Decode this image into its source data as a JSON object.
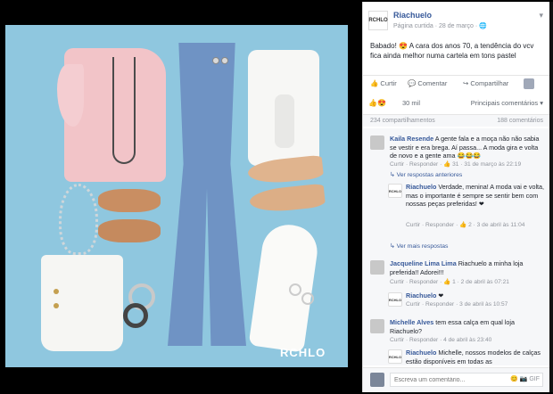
{
  "page": {
    "name": "Riachuelo",
    "avatar_text": "RCHLO",
    "meta": "Página curtida · 28 de março · 🌐"
  },
  "post": {
    "text": "Babado! 😍 A cara dos anos 70, a tendência do vcv fica ainda melhor numa cartela em tons pastel"
  },
  "photo": {
    "logo": "RCHLO"
  },
  "actions": {
    "like": "👍 Curtir",
    "comment": "💬 Comentar",
    "share": "↪ Compartilhar"
  },
  "reactions": {
    "icons": "👍😍",
    "count": "30 mil",
    "sort": "Principais comentários ▾"
  },
  "stats": {
    "shares": "234 compartilhamentos",
    "comments": "188 comentários"
  },
  "comments": [
    {
      "name": "Kaila Resende",
      "text": "A gente fala e a moça não não sabia se vestir e era brega. Aí passa... A moda gira e volta de novo e a gente ama 😂😂😂",
      "meta": "Curtir · Responder · 👍 31 · 31 de março às 22:19",
      "link": "↳ Ver respostas anteriores"
    },
    {
      "name": "Riachuelo",
      "text": "Verdade, menina! A moda vai e volta, mas o importante é sempre se sentir bem com nossas peças preferidas! ❤",
      "meta": "Curtir · Responder · 👍 2 · 3 de abril às 11:04",
      "link": "↳ Ver mais respostas"
    },
    {
      "name": "Jacqueline Lima Lima",
      "text": "Riachuelo a minha loja preferida!! Adorei!!!",
      "meta": "Curtir · Responder · 👍 1 · 2 de abril às 07:21"
    },
    {
      "name": "Riachuelo",
      "text": "❤",
      "meta": "Curtir · Responder · 3 de abril às 10:57"
    },
    {
      "name": "Michelle Alves",
      "text": "tem essa calça em qual loja Riachuelo?",
      "meta": "Curtir · Responder · 4 de abril às 23:40"
    },
    {
      "name": "Riachuelo",
      "text": "Michelle, nossos modelos de calças estão disponíveis em todas as"
    }
  ],
  "composer": {
    "placeholder": "Escreva um comentário...",
    "icons": "😊 📷 GIF"
  },
  "colors": {
    "accent": "#365899",
    "photo_bg": "#8fc7df"
  }
}
